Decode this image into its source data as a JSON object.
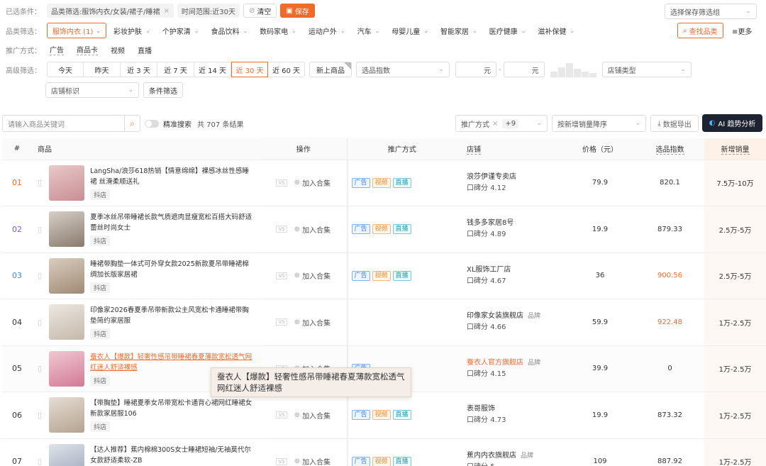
{
  "filters": {
    "selected_label": "已选条件：",
    "chips": [
      "品类筛选:服饰内衣/女装/裙子/睡裙",
      "时间范围:近30天"
    ],
    "clear_label": "清空",
    "save_label": "保存",
    "saved_group_placeholder": "选择保存筛选组"
  },
  "category": {
    "label": "品类筛选：",
    "active": "服饰内衣 (1)",
    "items": [
      "彩妆护肤",
      "个护家清",
      "食品饮料",
      "数码家电",
      "运动户外",
      "汽车",
      "母婴儿童",
      "智能家居",
      "医疗健康",
      "滋补保健"
    ],
    "find_label": "查找品类",
    "more_label": "更多"
  },
  "promo": {
    "label": "推广方式：",
    "items": [
      "广告",
      "商品卡",
      "视频",
      "直播"
    ]
  },
  "advanced": {
    "label": "高级筛选：",
    "time_ranges": [
      "今天",
      "昨天",
      "近 3 天",
      "近 7 天",
      "近 14 天",
      "近 30 天",
      "近 60 天"
    ],
    "active_time": "近 30 天",
    "new_product_label": "新上商品",
    "index_placeholder": "选品指数",
    "price_unit": "元",
    "price_dash": "-",
    "shop_type_placeholder": "店铺类型",
    "shop_tag_placeholder": "店铺标识",
    "condition_label": "条件筛选"
  },
  "search": {
    "placeholder": "请输入商品关键词",
    "precise_label": "精准搜索",
    "result_text": "共 707 条结果",
    "promo_select": "推广方式",
    "promo_plus": "+9",
    "sort_select": "按新增销量降序",
    "export_label": "数据导出",
    "ai_label": "AI 趋势分析"
  },
  "table": {
    "headers": {
      "rank": "#",
      "product": "商品",
      "op": "操作",
      "promo": "推广方式",
      "shop": "店铺",
      "price": "价格（元）",
      "index": "选品指数",
      "sales": "新增销量"
    },
    "add_label": "加入合集",
    "tags": [
      "广告",
      "视频",
      "直播"
    ],
    "shop_badge": "抖店",
    "rating_prefix": "口碑分",
    "brand_label": "品牌",
    "rows": [
      {
        "rank": "01",
        "name": "LangSha/浪莎618热销【情意绵绵】裸感冰丝性感睡裙 丝滑柔顺送礼",
        "shop": "浪莎伊谨专卖店",
        "rating": "4.12",
        "price": "79.9",
        "index": "820.1",
        "sales": "7.5万-10万",
        "rank_color": "#f06a2a",
        "brand": "",
        "index_red": false,
        "tags": 3
      },
      {
        "rank": "02",
        "name": "夏季冰丝吊带睡裙长款气质遮肉显瘦宽松百搭大码舒适蕾丝时尚女士",
        "shop": "钱多多家居8号",
        "rating": "4.89",
        "price": "19.9",
        "index": "879.33",
        "sales": "2.5万-5万",
        "rank_color": "#7c5cd6",
        "brand": "",
        "index_red": false,
        "tags": 3
      },
      {
        "rank": "03",
        "name": "睡裙带胸垫一体式可外穿女款2025新款夏吊带睡裙棉绸加长版家居裙",
        "shop": "XL服饰工厂店",
        "rating": "4.67",
        "price": "36",
        "index": "900.56",
        "sales": "2.5万-5万",
        "rank_color": "#3b8be0",
        "brand": "",
        "index_red": true,
        "tags": 3
      },
      {
        "rank": "04",
        "name": "印像家2026春夏季吊带新款公主风宽松卡通睡裙带胸垫简约家居服",
        "shop": "印像家女装旗舰店",
        "rating": "4.66",
        "price": "59.9",
        "index": "922.48",
        "sales": "1万-2.5万",
        "rank_color": "#333333",
        "brand": "品牌",
        "index_red": true,
        "tags": 0
      },
      {
        "rank": "05",
        "name": "蚕衣人【爆款】轻奢性感吊带睡裙春夏薄款宽松透气网红迷人舒适裸感",
        "shop": "蚕衣人官方旗舰店",
        "rating": "4.15",
        "price": "39.9",
        "index": "0",
        "sales": "1万-2.5万",
        "rank_color": "#333333",
        "brand": "品牌",
        "index_red": false,
        "tags": 1
      },
      {
        "rank": "06",
        "name": "【带胸垫】睡裙夏季女吊带宽松卡通背心裙网红睡裙女新款家居服106",
        "shop": "表哥服饰",
        "rating": "4.73",
        "price": "19.9",
        "index": "873.32",
        "sales": "1万-2.5万",
        "rank_color": "#333333",
        "brand": "",
        "index_red": false,
        "tags": 3
      },
      {
        "rank": "07",
        "name": "【达人推荐】蕉内棉棉300S女士睡裙短袖/无袖莫代尔女款舒适柔软-ZB",
        "shop": "蕉内内衣旗舰店",
        "rating": "5",
        "price": "109",
        "index": "887.92",
        "sales": "1万-2.5万",
        "rank_color": "#333333",
        "brand": "品牌",
        "index_red": false,
        "tags": 3
      }
    ]
  },
  "tooltip": "蚕衣人【爆款】轻奢性感吊带睡裙春夏薄款宽松透气网红迷人舒适裸感",
  "colors": {
    "accent": "#f06a2a",
    "ad": "#3b82f6",
    "video": "#f08a2a",
    "live": "#1aa3b8"
  }
}
